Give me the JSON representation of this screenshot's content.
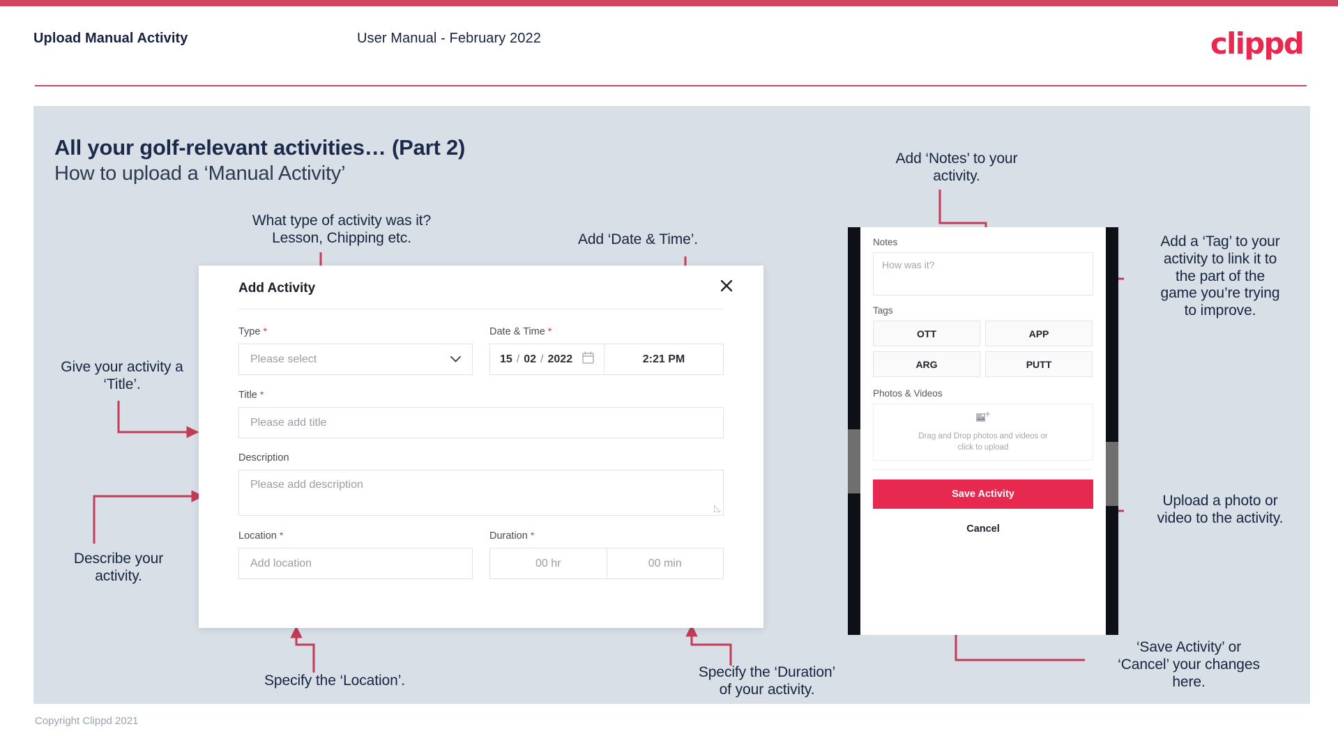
{
  "header": {
    "title": "Upload Manual Activity",
    "subtitle": "User Manual - February 2022",
    "logo": "clippd"
  },
  "slide": {
    "title": "All your golf-relevant activities… (Part 2)",
    "subtitle": "How to upload a ‘Manual Activity’"
  },
  "footer": {
    "copyright": "Copyright Clippd 2021"
  },
  "colors": {
    "brand_pink": "#e8294f",
    "header_rule": "#d1455f",
    "slide_bg": "#d9dfe6",
    "text_navy": "#16243f",
    "arrow": "#c43b56"
  },
  "dialog": {
    "title": "Add Activity",
    "close_icon": "close-icon",
    "fields": {
      "type": {
        "label": "Type",
        "required": "*",
        "placeholder": "Please select",
        "chevron": "chevron-down-icon"
      },
      "datetime": {
        "label": "Date & Time",
        "required": "*",
        "day": "15",
        "month": "02",
        "year": "2022",
        "sep": "/",
        "calendar_icon": "calendar-icon",
        "time": "2:21 PM"
      },
      "title": {
        "label": "Title",
        "required": "*",
        "placeholder": "Please add title"
      },
      "description": {
        "label": "Description",
        "placeholder": "Please add description"
      },
      "location": {
        "label": "Location",
        "required": "*",
        "placeholder": "Add location"
      },
      "duration": {
        "label": "Duration",
        "required": "*",
        "hours": "00 hr",
        "minutes": "00 min"
      }
    }
  },
  "phone": {
    "notes": {
      "label": "Notes",
      "placeholder": "How was it?"
    },
    "tags": {
      "label": "Tags",
      "items": [
        "OTT",
        "APP",
        "ARG",
        "PUTT"
      ]
    },
    "photos": {
      "label": "Photos & Videos",
      "icon": "add-image-icon",
      "line1": "Drag and Drop photos and videos or",
      "line2": "click to upload"
    },
    "save_label": "Save Activity",
    "cancel_label": "Cancel"
  },
  "annotations": {
    "type": "What type of activity was it?\nLesson, Chipping etc.",
    "datetime": "Add ‘Date & Time’.",
    "title": "Give your activity a\n‘Title’.",
    "description": "Describe your\nactivity.",
    "location": "Specify the ‘Location’.",
    "duration": "Specify the ‘Duration’\nof your activity.",
    "notes": "Add ‘Notes’ to your\nactivity.",
    "tags": "Add a ‘Tag’ to your\nactivity to link it to\nthe part of the\ngame you’re trying\nto improve.",
    "upload": "Upload a photo or\nvideo to the activity.",
    "save": "‘Save Activity’ or\n‘Cancel’ your changes\nhere."
  }
}
